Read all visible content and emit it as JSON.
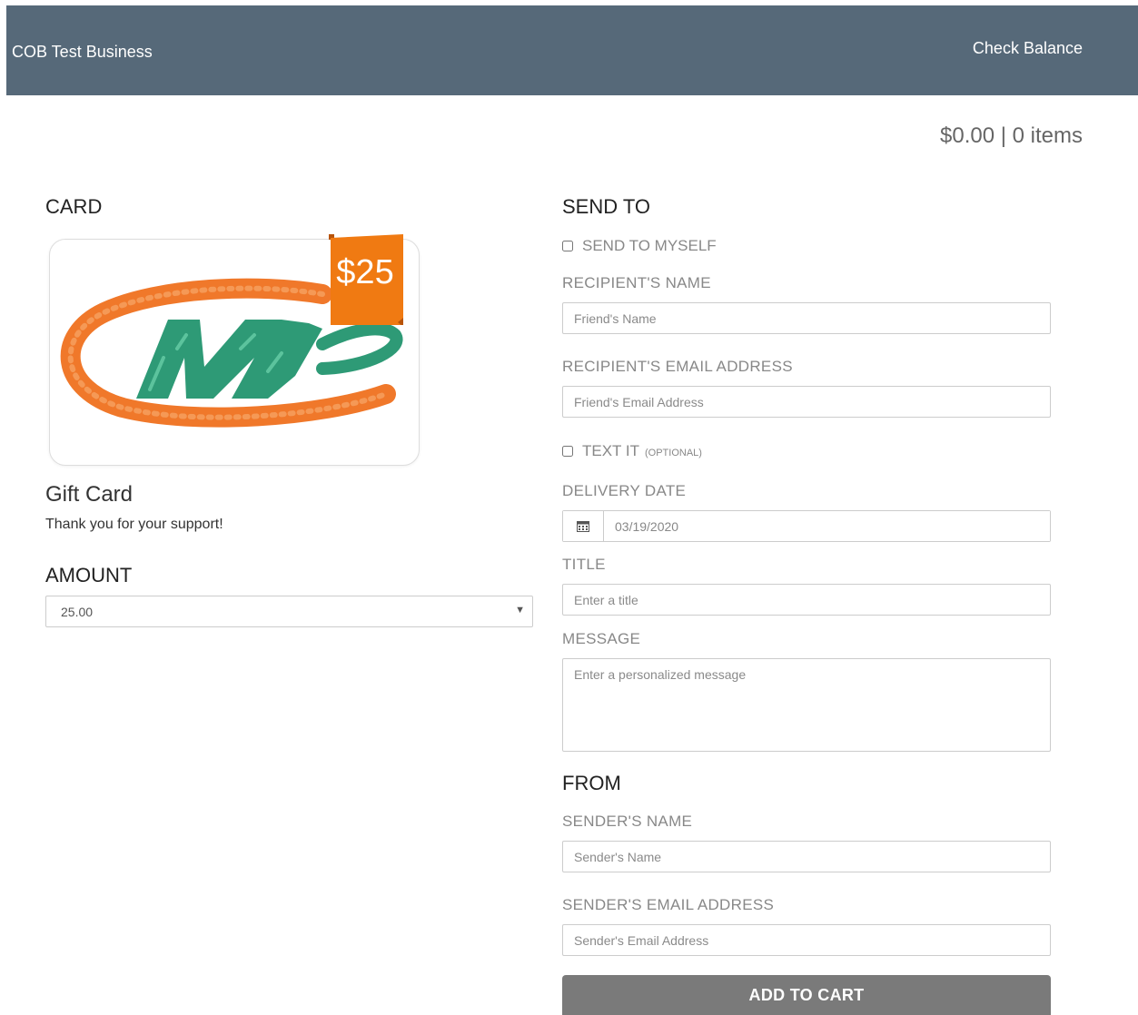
{
  "header": {
    "brand": "COB Test Business",
    "check_balance": "Check Balance",
    "colors": {
      "navbar": "#566979"
    }
  },
  "cart": {
    "summary": "$0.00 | 0 items"
  },
  "card_section": {
    "title": "CARD",
    "price_tag": "$25",
    "gift_title": "Gift Card",
    "gift_description": "Thank you for your support!",
    "colors": {
      "ribbon": "#f07a12",
      "logo_orange": "#f0782a",
      "logo_green": "#2e9a76"
    }
  },
  "amount_section": {
    "title": "AMOUNT",
    "selected_value": "25.00",
    "arrow_icon": "caret-down-icon"
  },
  "send_to": {
    "title": "SEND TO",
    "send_to_myself": "SEND TO MYSELF",
    "recipient_name_label": "RECIPIENT'S NAME",
    "recipient_name_placeholder": "Friend's Name",
    "recipient_email_label": "RECIPIENT'S EMAIL ADDRESS",
    "recipient_email_placeholder": "Friend's Email Address",
    "text_it": "TEXT IT",
    "text_it_optional": "(OPTIONAL)",
    "delivery_date_label": "DELIVERY DATE",
    "delivery_date_value": "03/19/2020",
    "calendar_icon": "calendar-icon",
    "title_label": "TITLE",
    "title_placeholder": "Enter a title",
    "message_label": "MESSAGE",
    "message_placeholder": "Enter a personalized message"
  },
  "from": {
    "title": "FROM",
    "sender_name_label": "SENDER'S NAME",
    "sender_name_placeholder": "Sender's Name",
    "sender_email_label": "SENDER'S EMAIL ADDRESS",
    "sender_email_placeholder": "Sender's Email Address"
  },
  "actions": {
    "add_to_cart": "ADD TO CART",
    "colors": {
      "button": "#7a7a7a"
    }
  }
}
